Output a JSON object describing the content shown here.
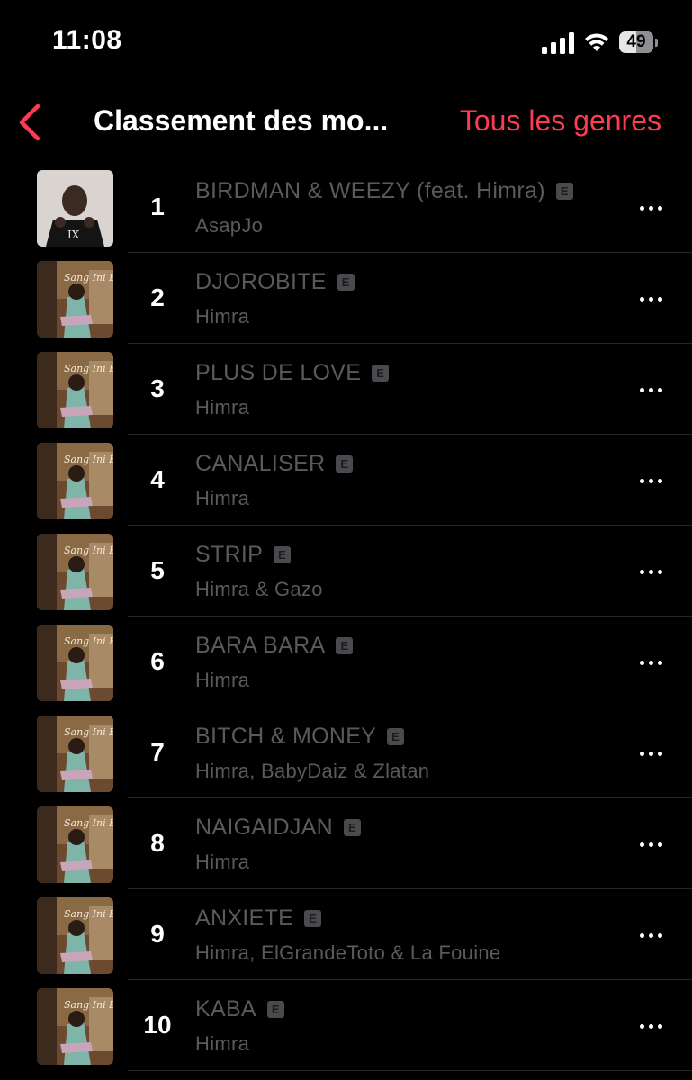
{
  "status_bar": {
    "time": "11:08",
    "battery_level": "49",
    "battery_fraction": 0.49,
    "icons": [
      "signal-icon",
      "wifi-icon",
      "battery-icon"
    ]
  },
  "nav": {
    "back_icon": "chevron-left-icon",
    "title": "Classement des mo...",
    "action_label": "Tous les genres",
    "accent_color": "#ff3b52"
  },
  "explicit_label": "E",
  "tracks": [
    {
      "rank": "1",
      "title": "BIRDMAN & WEEZY (feat. Himra)",
      "artist": "AsapJo",
      "explicit": true,
      "artwork": "album-artwork-asapjo"
    },
    {
      "rank": "2",
      "title": "DJOROBITE",
      "artist": "Himra",
      "explicit": true,
      "artwork": "album-artwork-himra"
    },
    {
      "rank": "3",
      "title": "PLUS DE LOVE",
      "artist": "Himra",
      "explicit": true,
      "artwork": "album-artwork-himra"
    },
    {
      "rank": "4",
      "title": "CANALISER",
      "artist": "Himra",
      "explicit": true,
      "artwork": "album-artwork-himra"
    },
    {
      "rank": "5",
      "title": "STRIP",
      "artist": "Himra & Gazo",
      "explicit": true,
      "artwork": "album-artwork-himra"
    },
    {
      "rank": "6",
      "title": "BARA BARA",
      "artist": "Himra",
      "explicit": true,
      "artwork": "album-artwork-himra"
    },
    {
      "rank": "7",
      "title": "BITCH & MONEY",
      "artist": "Himra, BabyDaiz & Zlatan",
      "explicit": true,
      "artwork": "album-artwork-himra"
    },
    {
      "rank": "8",
      "title": "NAIGAIDJAN",
      "artist": "Himra",
      "explicit": true,
      "artwork": "album-artwork-himra"
    },
    {
      "rank": "9",
      "title": "ANXIETE",
      "artist": "Himra, ElGrandeToto & La Fouine",
      "explicit": true,
      "artwork": "album-artwork-himra"
    },
    {
      "rank": "10",
      "title": "KABA",
      "artist": "Himra",
      "explicit": true,
      "artwork": "album-artwork-himra"
    }
  ]
}
